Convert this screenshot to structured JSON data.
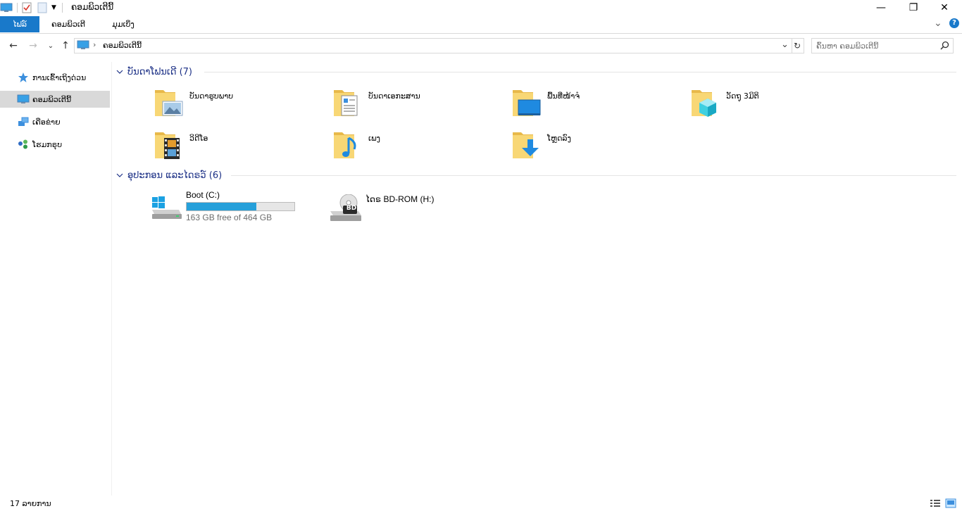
{
  "window": {
    "title": "ຄອມພິວເຕີນີ້",
    "controls": {
      "minimize": "—",
      "maximize": "❐",
      "close": "✕"
    }
  },
  "ribbon": {
    "tabs": [
      "ໄຟລ໌",
      "ຄອມພິວເຕີ",
      "ມຸມເບິ່ງ"
    ],
    "expand_glyph": "⌄",
    "help_glyph": "?"
  },
  "nav": {
    "back": "←",
    "forward": "→",
    "recent": "⌄",
    "up": "↑",
    "breadcrumb": [
      "ຄອມພິວເຕີນີ້"
    ],
    "breadcrumb_sep": "›",
    "address_dropdown": "⌄",
    "refresh": "↻",
    "search_placeholder": "ຄົ້ນຫາ ຄອມພິວເຕີນີ້"
  },
  "sidebar": {
    "items": [
      {
        "label": "ການເຂົ້າເຖິງດ່ວນ",
        "icon": "star-icon"
      },
      {
        "label": "ຄອມພິວເຕີນີ້",
        "icon": "computer-icon",
        "selected": true
      },
      {
        "label": "ເຄືອຂ່າຍ",
        "icon": "network-icon"
      },
      {
        "label": "ໂຮມກຣຸບ",
        "icon": "homegroup-icon"
      }
    ]
  },
  "folders_group": {
    "title": "ບັນດາໂຟນເດີ (7)",
    "items": [
      {
        "label": "ບັນດາຮູບພາບ",
        "icon": "pictures-folder-icon"
      },
      {
        "label": "ບັນດາເອກະສານ",
        "icon": "documents-folder-icon"
      },
      {
        "label": "ພື້ນທີ່ໜ້າຈໍ",
        "icon": "desktop-folder-icon"
      },
      {
        "label": "ວັດຖຸ 3ມິຕິ",
        "icon": "3d-objects-folder-icon"
      },
      {
        "label": "ວິດີໂອ",
        "icon": "videos-folder-icon"
      },
      {
        "label": "ເພງ",
        "icon": "music-folder-icon"
      },
      {
        "label": "ໂຫຼດລົງ",
        "icon": "downloads-folder-icon"
      }
    ]
  },
  "drives_group": {
    "title": "ອຸປະກອນ ແລະໄດຣວ໌ (6)",
    "items": [
      {
        "label": "Boot (C:)",
        "free_text": "163 GB free of 464 GB",
        "used_fraction": 0.649,
        "icon": "windows-drive-icon"
      },
      {
        "label": "ໄດຣ BD-ROM (H:)",
        "icon": "bd-drive-icon",
        "badge": "BD"
      }
    ]
  },
  "statusbar": {
    "count": "17 ລາຍການ"
  },
  "colors": {
    "accent": "#1979ca",
    "folder": "#f8d775",
    "group_title": "#1e3287",
    "progress": "#26a0da"
  }
}
